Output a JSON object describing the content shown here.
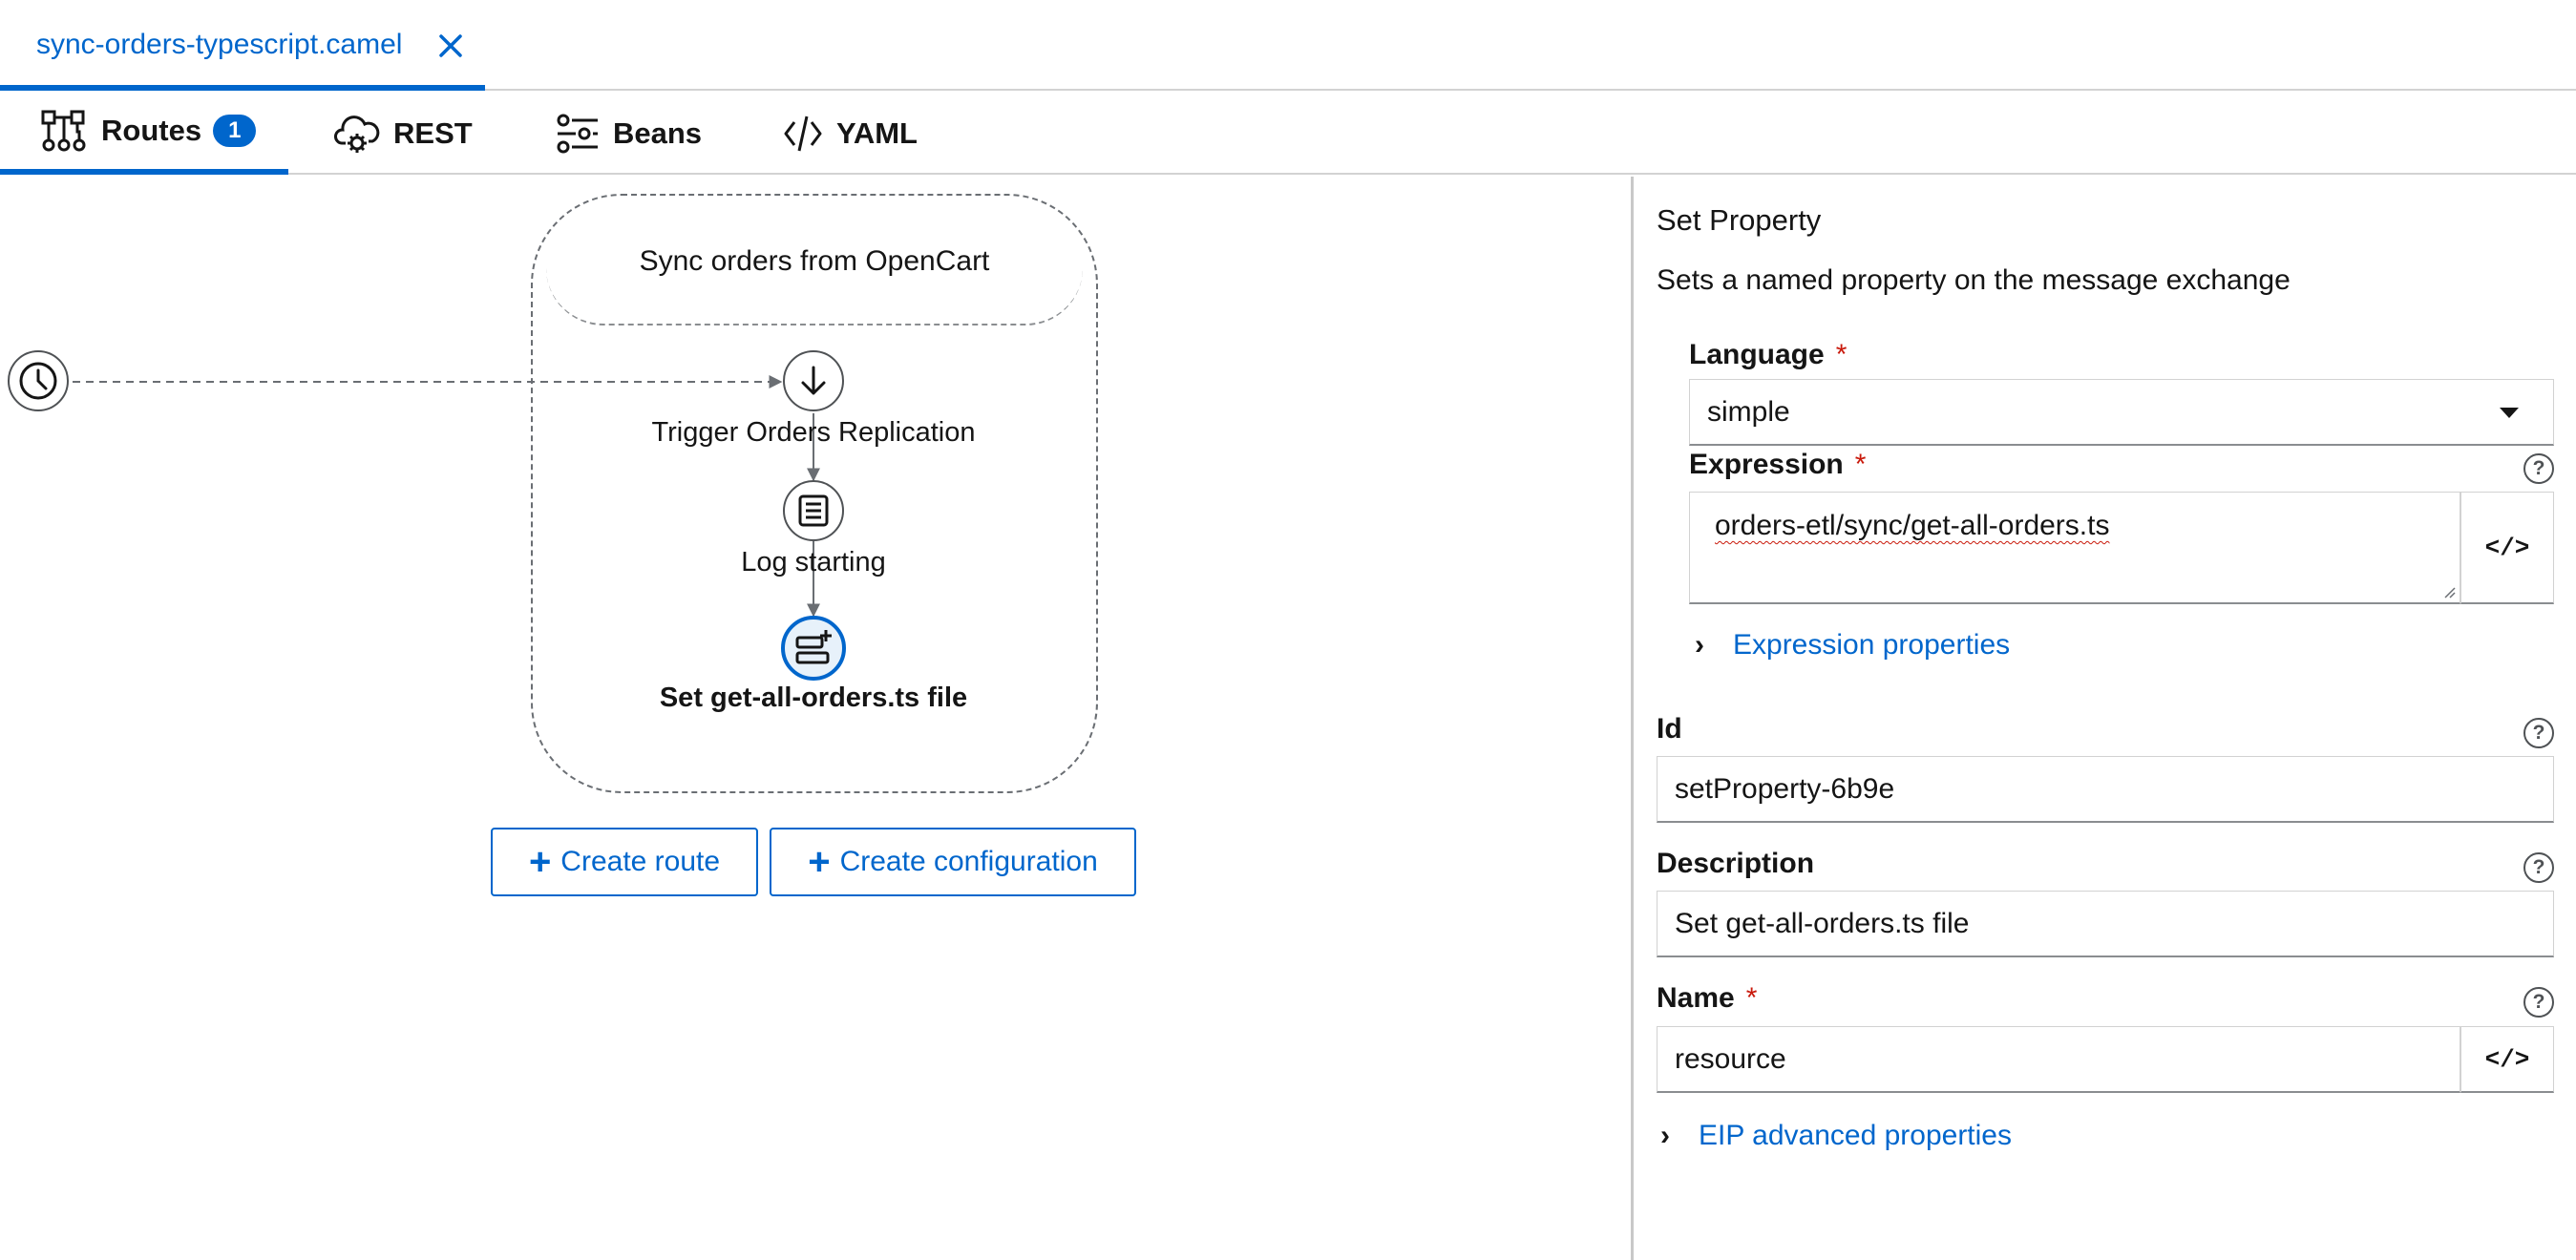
{
  "file_tab": {
    "name": "sync-orders-typescript.camel"
  },
  "view_tabs": [
    {
      "label": "Routes",
      "badge": "1"
    },
    {
      "label": "REST"
    },
    {
      "label": "Beans"
    },
    {
      "label": "YAML"
    }
  ],
  "canvas": {
    "route_title": "Sync orders from OpenCart",
    "nodes": [
      {
        "label": "Trigger Orders Replication"
      },
      {
        "label": "Log starting"
      },
      {
        "label": "Set get-all-orders.ts file"
      }
    ],
    "create_route_label": "Create route",
    "create_configuration_label": "Create configuration"
  },
  "panel": {
    "title": "Set Property",
    "description": "Sets a named property on the message exchange",
    "language": {
      "label": "Language",
      "required": "*",
      "value": "simple"
    },
    "expression": {
      "label": "Expression",
      "required": "*",
      "value": "orders-etl/sync/get-all-orders.ts"
    },
    "expression_properties": "Expression properties",
    "id": {
      "label": "Id",
      "value": "setProperty-6b9e"
    },
    "description_field": {
      "label": "Description",
      "value": "Set get-all-orders.ts file"
    },
    "name": {
      "label": "Name",
      "required": "*",
      "value": "resource"
    },
    "eip_advanced": "EIP advanced properties",
    "code_button": "</>",
    "help": "?"
  },
  "colors": {
    "accent": "#0066cc",
    "required": "#c9190b"
  }
}
